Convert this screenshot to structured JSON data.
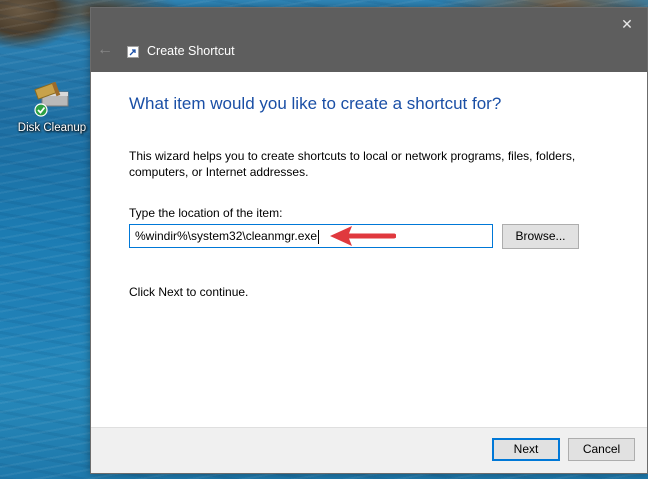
{
  "desktop": {
    "icon_label": "Disk Cleanup",
    "icon_name": "disk-cleanup-icon"
  },
  "dialog": {
    "title": "Create Shortcut",
    "heading": "What item would you like to create a shortcut for?",
    "description": "This wizard helps you to create shortcuts to local or network programs, files, folders, computers, or Internet addresses.",
    "location_label": "Type the location of the item:",
    "location_value": "%windir%\\system32\\cleanmgr.exe",
    "browse_label": "Browse...",
    "hint": "Click Next to continue.",
    "next_label": "Next",
    "cancel_label": "Cancel"
  },
  "colors": {
    "titlebar": "#5e5e5e",
    "heading": "#1a4fa6",
    "accent": "#0078d7",
    "arrow": "#e0393e"
  }
}
